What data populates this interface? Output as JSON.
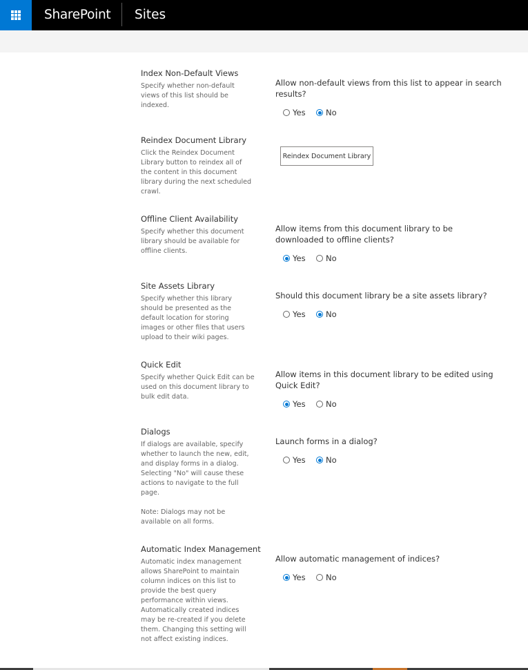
{
  "header": {
    "app_name": "SharePoint",
    "site_title": "Sites",
    "accent_color": "#0078d4"
  },
  "sections": [
    {
      "title": "Index Non-Default Views",
      "description_lines": [
        "Specify whether non-default",
        "views of this list should be",
        "indexed."
      ],
      "question_lines": [
        "Allow non-default views from this list to appear in search",
        "results?"
      ],
      "options": [
        "Yes",
        "No"
      ],
      "selected": "No"
    },
    {
      "title": "Reindex Document Library",
      "description_lines": [
        "Click the Reindex Document",
        "Library button to reindex all of",
        "the content in this document",
        "library during the next scheduled",
        "crawl."
      ],
      "button_label": "Reindex Document Library"
    },
    {
      "title": "Offline Client Availability",
      "description_lines": [
        "Specify whether this document",
        "library should be available for",
        "offline clients."
      ],
      "question_lines": [
        "Allow items from this document library to be",
        "downloaded to offline clients?"
      ],
      "options": [
        "Yes",
        "No"
      ],
      "selected": "Yes"
    },
    {
      "title": "Site Assets Library",
      "description_lines": [
        "Specify whether this library",
        "should be presented as the",
        "default location for storing",
        "images or other files that users",
        "upload to their wiki pages."
      ],
      "question_lines": [
        "Should this document library be a site assets library?"
      ],
      "options": [
        "Yes",
        "No"
      ],
      "selected": "No"
    },
    {
      "title": "Quick Edit",
      "description_lines": [
        "Specify whether Quick Edit can be",
        "used on this document library to",
        "bulk edit data."
      ],
      "question_lines": [
        "Allow items in this document library to be edited using",
        "Quick Edit?"
      ],
      "options": [
        "Yes",
        "No"
      ],
      "selected": "Yes"
    },
    {
      "title": "Dialogs",
      "description_lines": [
        "If dialogs are available, specify",
        "whether to launch the new, edit,",
        "and display forms in a dialog.",
        "Selecting \"No\" will cause these",
        "actions to navigate to the full",
        "page.",
        "",
        "Note: Dialogs may not be",
        "available on all forms."
      ],
      "question_lines": [
        "Launch forms in a dialog?"
      ],
      "options": [
        "Yes",
        "No"
      ],
      "selected": "No"
    },
    {
      "title": "Automatic Index Management",
      "description_lines": [
        "Automatic index management",
        "allows SharePoint to maintain",
        "column indices on this list to",
        "provide the best query",
        "performance within views.",
        "Automatically created indices",
        "may be re-created if you delete",
        "them. Changing this setting will",
        "not affect existing indices."
      ],
      "question_lines": [
        "Allow automatic management of indices?"
      ],
      "options": [
        "Yes",
        "No"
      ],
      "selected": "Yes"
    }
  ]
}
